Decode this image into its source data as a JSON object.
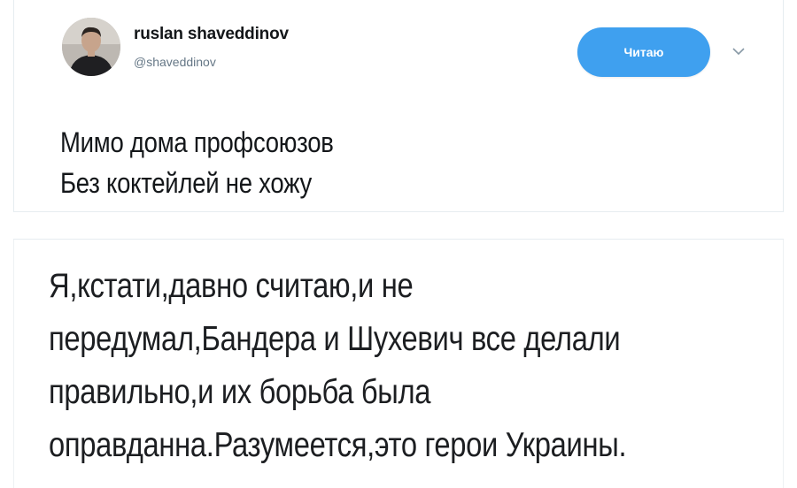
{
  "tweet": {
    "display_name": "ruslan shaveddinov",
    "handle": "@shaveddinov",
    "follow_label": "Читаю",
    "text_line1": "Мимо дома профсоюзов",
    "text_line2": "Без коктейлей не хожу",
    "accent_color": "#3fa0ef"
  },
  "comment": {
    "line1": "Я,кстати,давно считаю,и не",
    "line2": "передумал,Бандера и Шухевич все делали",
    "line3": "правильно,и их борьба была",
    "line4": "оправданна.Разумеется,это герои Украины."
  },
  "icons": {
    "caret": "chevron-down-icon",
    "avatar": "profile-photo"
  }
}
